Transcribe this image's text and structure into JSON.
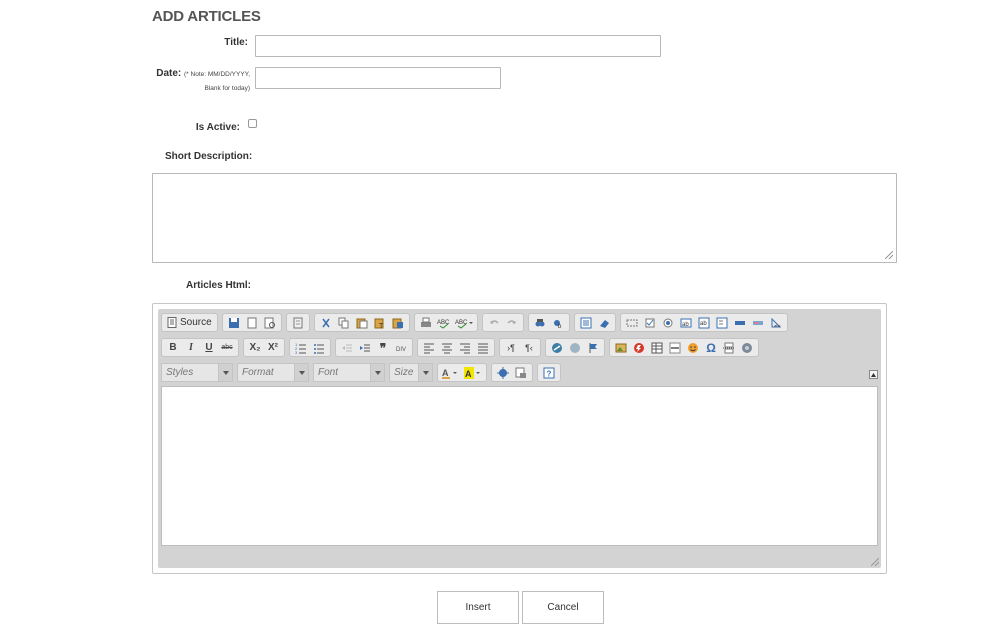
{
  "page": {
    "heading": "ADD ARTICLES"
  },
  "form": {
    "title_label": "Title:",
    "title_value": "",
    "date_label": "Date:",
    "date_note_line1": "(* Note: MM/DD/YYYY,",
    "date_note_line2": "Blank for today)",
    "date_value": "",
    "is_active_label": "Is Active:",
    "is_active_checked": false,
    "short_description_label": "Short Description:",
    "short_description_value": "",
    "articles_html_label": "Articles Html:"
  },
  "editor": {
    "source_label": "Source",
    "styles_placeholder": "Styles",
    "format_placeholder": "Format",
    "font_placeholder": "Font",
    "size_placeholder": "Size",
    "bold_label": "B",
    "italic_label": "I",
    "underline_label": "U",
    "strike_label": "abc",
    "subscript_label": "X₂",
    "superscript_label": "X²",
    "content": ""
  },
  "buttons": {
    "insert_label": "Insert",
    "cancel_label": "Cancel"
  }
}
